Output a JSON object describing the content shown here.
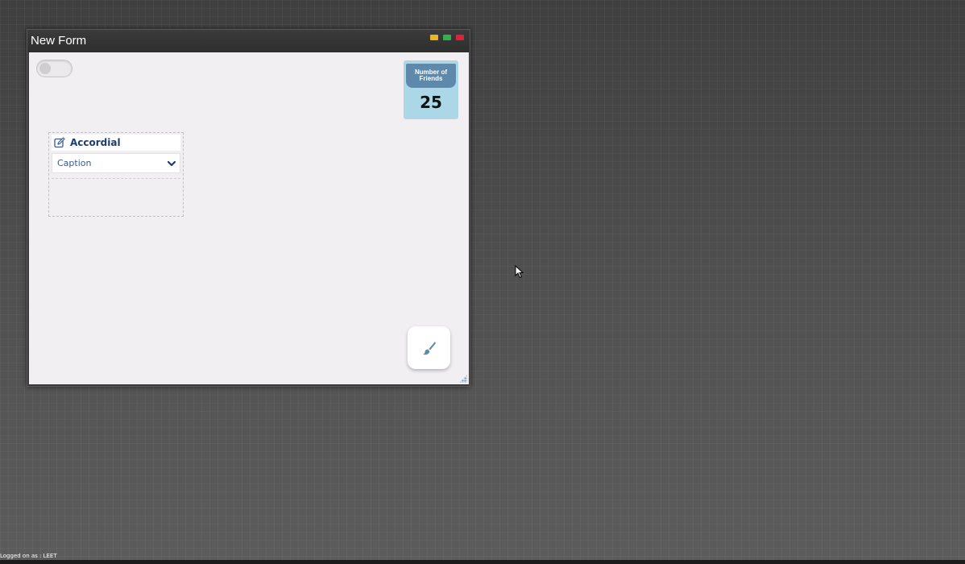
{
  "window": {
    "title": "New Form",
    "buttons": [
      {
        "name": "minimize",
        "color": "#e8b423"
      },
      {
        "name": "maximize",
        "color": "#2fb24a"
      },
      {
        "name": "close",
        "color": "#e0213a"
      }
    ]
  },
  "toggle": {
    "state": "off"
  },
  "stat_widget": {
    "label": "Number of Friends",
    "value": "25",
    "header_color": "#5e89ab",
    "background_color": "#acd7e6"
  },
  "accordion": {
    "title": "Accordial",
    "title_icon": "edit-icon",
    "items": [
      {
        "caption": "Caption",
        "icon": "chevron-down-icon"
      }
    ]
  },
  "fab": {
    "icon": "paint-brush-icon"
  },
  "status": {
    "logged_on": "Logged on as : LEET"
  }
}
